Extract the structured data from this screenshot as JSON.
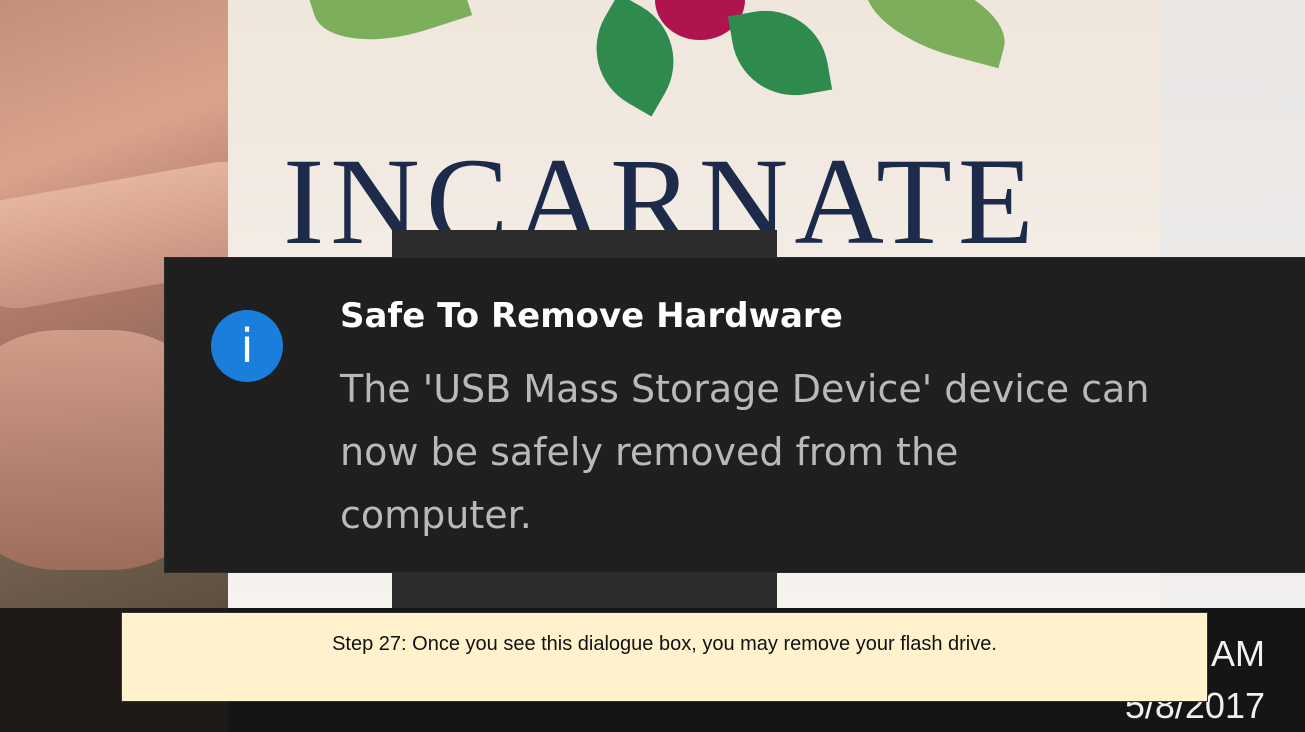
{
  "background": {
    "poster_text": "INCARNATE",
    "colors": {
      "poster_text": "#1d2a4a",
      "leaf": "#2f8a4e",
      "berry": "#b0144e"
    }
  },
  "notification": {
    "icon": "info-icon",
    "icon_glyph": "i",
    "title": "Safe To Remove Hardware",
    "body": "The 'USB Mass Storage Device' device can now be safely removed from the computer.",
    "colors": {
      "background": "#1f1f1f",
      "icon": "#1a7fdc",
      "title": "#ffffff",
      "body": "#b9b9b9"
    }
  },
  "taskbar": {
    "clock_time_partial": "AM",
    "clock_date_partial": "5/8/2017"
  },
  "caption": {
    "text": "Step 27: Once you see this dialogue box, you may remove your flash drive.",
    "colors": {
      "background": "#fff2cc"
    }
  }
}
